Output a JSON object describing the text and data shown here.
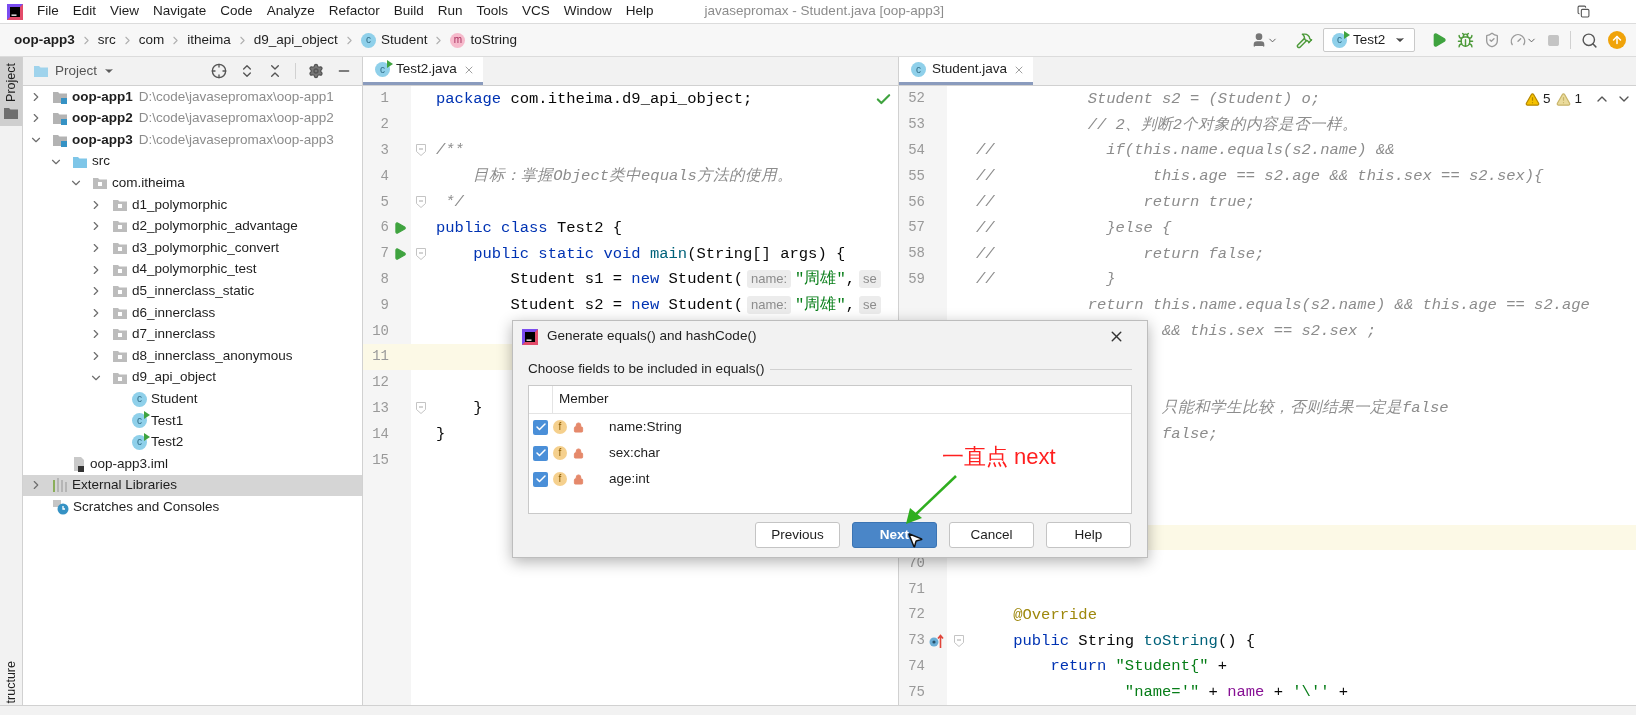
{
  "menu_bar": {
    "items": [
      "File",
      "Edit",
      "View",
      "Navigate",
      "Code",
      "Analyze",
      "Refactor",
      "Build",
      "Run",
      "Tools",
      "VCS",
      "Window",
      "Help"
    ],
    "title": "javasepromax - Student.java [oop-app3]"
  },
  "breadcrumbs": [
    {
      "label": "oop-app3",
      "kind": "module"
    },
    {
      "label": "src",
      "kind": "folder"
    },
    {
      "label": "com",
      "kind": "folder"
    },
    {
      "label": "itheima",
      "kind": "folder"
    },
    {
      "label": "d9_api_object",
      "kind": "folder"
    },
    {
      "label": "Student",
      "kind": "class",
      "icon_text": "c"
    },
    {
      "label": "toString",
      "kind": "method",
      "icon_text": "m"
    }
  ],
  "toolbar": {
    "run_config": "Test2",
    "run_config_icon_text": "c"
  },
  "side_strip": {
    "top_tab": {
      "label": "Project",
      "selected": true
    },
    "bottom_tab": {
      "label": "tructure",
      "selected": false
    }
  },
  "project_panel": {
    "title": "Project",
    "tree": [
      {
        "label": "oop-app1",
        "kind": "module",
        "path": "D:\\code\\javasepromax\\oop-app1",
        "expanded": false,
        "selected": false
      },
      {
        "label": "oop-app2",
        "kind": "module",
        "path": "D:\\code\\javasepromax\\oop-app2",
        "expanded": false,
        "selected": false
      },
      {
        "label": "oop-app3",
        "kind": "module",
        "path": "D:\\code\\javasepromax\\oop-app3",
        "expanded": true,
        "selected": false,
        "children": [
          {
            "label": "src",
            "kind": "source",
            "expanded": true,
            "selected": false,
            "children": [
              {
                "label": "com.itheima",
                "kind": "package",
                "expanded": true,
                "selected": false,
                "children": [
                  {
                    "label": "d1_polymorphic",
                    "kind": "package",
                    "expanded": false,
                    "selected": false
                  },
                  {
                    "label": "d2_polymorphic_advantage",
                    "kind": "package",
                    "expanded": false,
                    "selected": false
                  },
                  {
                    "label": "d3_polymorphic_convert",
                    "kind": "package",
                    "expanded": false,
                    "selected": false
                  },
                  {
                    "label": "d4_polymorphic_test",
                    "kind": "package",
                    "expanded": false,
                    "selected": false
                  },
                  {
                    "label": "d5_innerclass_static",
                    "kind": "package",
                    "expanded": false,
                    "selected": false
                  },
                  {
                    "label": "d6_innerclass",
                    "kind": "package",
                    "expanded": false,
                    "selected": false
                  },
                  {
                    "label": "d7_innerclass",
                    "kind": "package",
                    "expanded": false,
                    "selected": false
                  },
                  {
                    "label": "d8_innerclass_anonymous",
                    "kind": "package",
                    "expanded": false,
                    "selected": false
                  },
                  {
                    "label": "d9_api_object",
                    "kind": "package",
                    "expanded": true,
                    "selected": false,
                    "children": [
                      {
                        "label": "Student",
                        "kind": "class",
                        "icon_text": "c",
                        "selected": false
                      },
                      {
                        "label": "Test1",
                        "kind": "runnable_class",
                        "icon_text": "c",
                        "selected": false
                      },
                      {
                        "label": "Test2",
                        "kind": "runnable_class",
                        "icon_text": "c",
                        "selected": false
                      }
                    ]
                  }
                ]
              }
            ]
          },
          {
            "label": "oop-app3.iml",
            "kind": "module_file",
            "selected": false
          }
        ]
      },
      {
        "label": "External Libraries",
        "kind": "libraries",
        "expanded": false,
        "selected": true
      },
      {
        "label": "Scratches and Consoles",
        "kind": "scratches",
        "selected": false
      }
    ]
  },
  "editors": [
    {
      "tab": {
        "label": "Test2.java",
        "icon_text": "c",
        "runnable": true,
        "selected": true
      },
      "inspection": {
        "kind": "ok"
      },
      "lines": [
        {
          "number": "1",
          "kind": "plain",
          "fold": false,
          "current": false,
          "tokens": [
            {
              "kind": "keyword",
              "text": "package"
            },
            {
              "kind": "plain",
              "text": " com.itheima.d9_api_object;"
            }
          ]
        },
        {
          "number": "2",
          "kind": "plain",
          "fold": false,
          "current": false
        },
        {
          "number": "3",
          "kind": "plain",
          "fold": true,
          "current": false,
          "tokens": [
            {
              "kind": "comment",
              "text": "/**"
            }
          ]
        },
        {
          "number": "4",
          "kind": "plain",
          "fold": false,
          "current": false,
          "tokens": [
            {
              "kind": "comment",
              "text": "    目标：掌握Object类中equals方法的使用。"
            }
          ]
        },
        {
          "number": "5",
          "kind": "plain",
          "fold": true,
          "current": false,
          "tokens": [
            {
              "kind": "comment",
              "text": " */"
            }
          ]
        },
        {
          "number": "6",
          "kind": "run",
          "fold": false,
          "current": false,
          "tokens": [
            {
              "kind": "keyword",
              "text": "public class"
            },
            {
              "kind": "plain",
              "text": " Test2 {"
            }
          ]
        },
        {
          "number": "7",
          "kind": "run",
          "fold": true,
          "current": false,
          "tokens": [
            {
              "kind": "keyword",
              "text": "    public static void "
            },
            {
              "kind": "method",
              "text": "main"
            },
            {
              "kind": "plain",
              "text": "(String[] args) {"
            }
          ]
        },
        {
          "number": "8",
          "kind": "plain",
          "fold": false,
          "current": false,
          "tokens": [
            {
              "kind": "plain",
              "text": "        Student s1 = "
            },
            {
              "kind": "keyword",
              "text": "new"
            },
            {
              "kind": "plain",
              "text": " Student("
            },
            {
              "kind": "hint",
              "text": "name:"
            },
            {
              "kind": "string",
              "text": "\"周雄\""
            },
            {
              "kind": "plain",
              "text": ","
            },
            {
              "kind": "hint",
              "text": "se"
            }
          ]
        },
        {
          "number": "9",
          "kind": "plain",
          "fold": false,
          "current": false,
          "tokens": [
            {
              "kind": "plain",
              "text": "        Student s2 = "
            },
            {
              "kind": "keyword",
              "text": "new"
            },
            {
              "kind": "plain",
              "text": " Student("
            },
            {
              "kind": "hint",
              "text": "name:"
            },
            {
              "kind": "string",
              "text": "\"周雄\""
            },
            {
              "kind": "plain",
              "text": ","
            },
            {
              "kind": "hint",
              "text": "se"
            }
          ]
        },
        {
          "number": "10",
          "kind": "plain",
          "fold": false,
          "current": false
        },
        {
          "number": "11",
          "kind": "plain",
          "fold": false,
          "current": true
        },
        {
          "number": "12",
          "kind": "plain",
          "fold": false,
          "current": false
        },
        {
          "number": "13",
          "kind": "plain",
          "fold": true,
          "current": false,
          "tokens": [
            {
              "kind": "plain",
              "text": "    }"
            }
          ]
        },
        {
          "number": "14",
          "kind": "plain",
          "fold": false,
          "current": false,
          "tokens": [
            {
              "kind": "plain",
              "text": "}"
            }
          ]
        },
        {
          "number": "15",
          "kind": "plain",
          "fold": false,
          "current": false
        }
      ]
    },
    {
      "tab": {
        "label": "Student.java",
        "icon_text": "c",
        "runnable": false,
        "selected": true
      },
      "inspection": {
        "kind": "warnings",
        "warnings": "5",
        "weak_warnings": "1"
      },
      "lines": [
        {
          "number": "52",
          "kind": "plain",
          "fold": false,
          "current": false,
          "tokens": [
            {
              "kind": "dim",
              "text": "            Student s2 = (Student) o;"
            }
          ]
        },
        {
          "number": "53",
          "kind": "plain",
          "fold": false,
          "current": false,
          "tokens": [
            {
              "kind": "dim",
              "text": "            // 2、判断2个对象的内容是否一样。"
            }
          ]
        },
        {
          "number": "54",
          "kind": "plain",
          "fold": false,
          "current": false,
          "tokens": [
            {
              "kind": "dim",
              "text": "//            if(this.name.equals(s2.name) &&"
            }
          ]
        },
        {
          "number": "55",
          "kind": "plain",
          "fold": false,
          "current": false,
          "tokens": [
            {
              "kind": "dim",
              "text": "//                 this.age == s2.age && this.sex == s2.sex){"
            }
          ]
        },
        {
          "number": "56",
          "kind": "plain",
          "fold": false,
          "current": false,
          "tokens": [
            {
              "kind": "dim",
              "text": "//                return true;"
            }
          ]
        },
        {
          "number": "57",
          "kind": "plain",
          "fold": false,
          "current": false,
          "tokens": [
            {
              "kind": "dim",
              "text": "//            }else {"
            }
          ]
        },
        {
          "number": "58",
          "kind": "plain",
          "fold": false,
          "current": false,
          "tokens": [
            {
              "kind": "dim",
              "text": "//                return false;"
            }
          ]
        },
        {
          "number": "59",
          "kind": "plain",
          "fold": false,
          "current": false,
          "tokens": [
            {
              "kind": "dim",
              "text": "//            }"
            }
          ]
        },
        {
          "kind": "plain",
          "fold": false,
          "current": false,
          "tokens": [
            {
              "kind": "dim",
              "text": "            return this.name.equals(s2.name) && this.age == s2.age"
            }
          ]
        },
        {
          "kind": "plain",
          "fold": false,
          "current": false,
          "tokens": [
            {
              "kind": "dim",
              "text": "                    && this.sex == s2.sex ;"
            }
          ]
        },
        {
          "kind": "plain",
          "fold": false,
          "current": false
        },
        {
          "kind": "plain",
          "fold": false,
          "current": false
        },
        {
          "kind": "plain",
          "fold": false,
          "current": false,
          "tokens": [
            {
              "kind": "dim",
              "text": "                    只能和学生比较，否则结果一定是false"
            }
          ]
        },
        {
          "kind": "plain",
          "fold": false,
          "current": false,
          "tokens": [
            {
              "kind": "dim",
              "text": "                    false;"
            }
          ]
        },
        {
          "kind": "plain",
          "fold": false,
          "current": false
        },
        {
          "kind": "plain",
          "fold": false,
          "current": false
        },
        {
          "kind": "plain",
          "fold": false,
          "current": false
        },
        {
          "kind": "plain",
          "fold": false,
          "current": true
        },
        {
          "number": "70",
          "kind": "plain",
          "fold": false,
          "current": false
        },
        {
          "number": "71",
          "kind": "plain",
          "fold": false,
          "current": false
        },
        {
          "number": "72",
          "kind": "plain",
          "fold": false,
          "current": false,
          "tokens": [
            {
              "kind": "annotation",
              "text": "    @Override"
            }
          ]
        },
        {
          "number": "73",
          "kind": "override",
          "fold": true,
          "current": false,
          "tokens": [
            {
              "kind": "keyword",
              "text": "    public"
            },
            {
              "kind": "plain",
              "text": " String "
            },
            {
              "kind": "method",
              "text": "toString"
            },
            {
              "kind": "plain",
              "text": "() {"
            }
          ]
        },
        {
          "number": "74",
          "kind": "plain",
          "fold": false,
          "current": false,
          "tokens": [
            {
              "kind": "keyword",
              "text": "        return "
            },
            {
              "kind": "string",
              "text": "\"Student{\""
            },
            {
              "kind": "plain",
              "text": " +"
            }
          ]
        },
        {
          "number": "75",
          "kind": "plain",
          "fold": false,
          "current": false,
          "tokens": [
            {
              "kind": "string",
              "text": "                \"name='\""
            },
            {
              "kind": "plain",
              "text": " + "
            },
            {
              "kind": "field",
              "text": "name"
            },
            {
              "kind": "plain",
              "text": " + "
            },
            {
              "kind": "string",
              "text": "'\\''"
            },
            {
              "kind": "plain",
              "text": " +"
            }
          ]
        }
      ]
    }
  ],
  "dialog": {
    "title": "Generate equals() and hashCode()",
    "prompt": "Choose fields to be included in equals()",
    "column": "Member",
    "members": [
      {
        "label": "name:String",
        "icon_text": "f",
        "checked": true
      },
      {
        "label": "sex:char",
        "icon_text": "f",
        "checked": true
      },
      {
        "label": "age:int",
        "icon_text": "f",
        "checked": true
      }
    ],
    "buttons": [
      {
        "label": "Previous",
        "primary": false
      },
      {
        "label": "Next",
        "primary": true
      },
      {
        "label": "Cancel",
        "primary": false
      },
      {
        "label": "Help",
        "primary": false
      }
    ]
  },
  "annotation": {
    "text": "一直点 next"
  }
}
